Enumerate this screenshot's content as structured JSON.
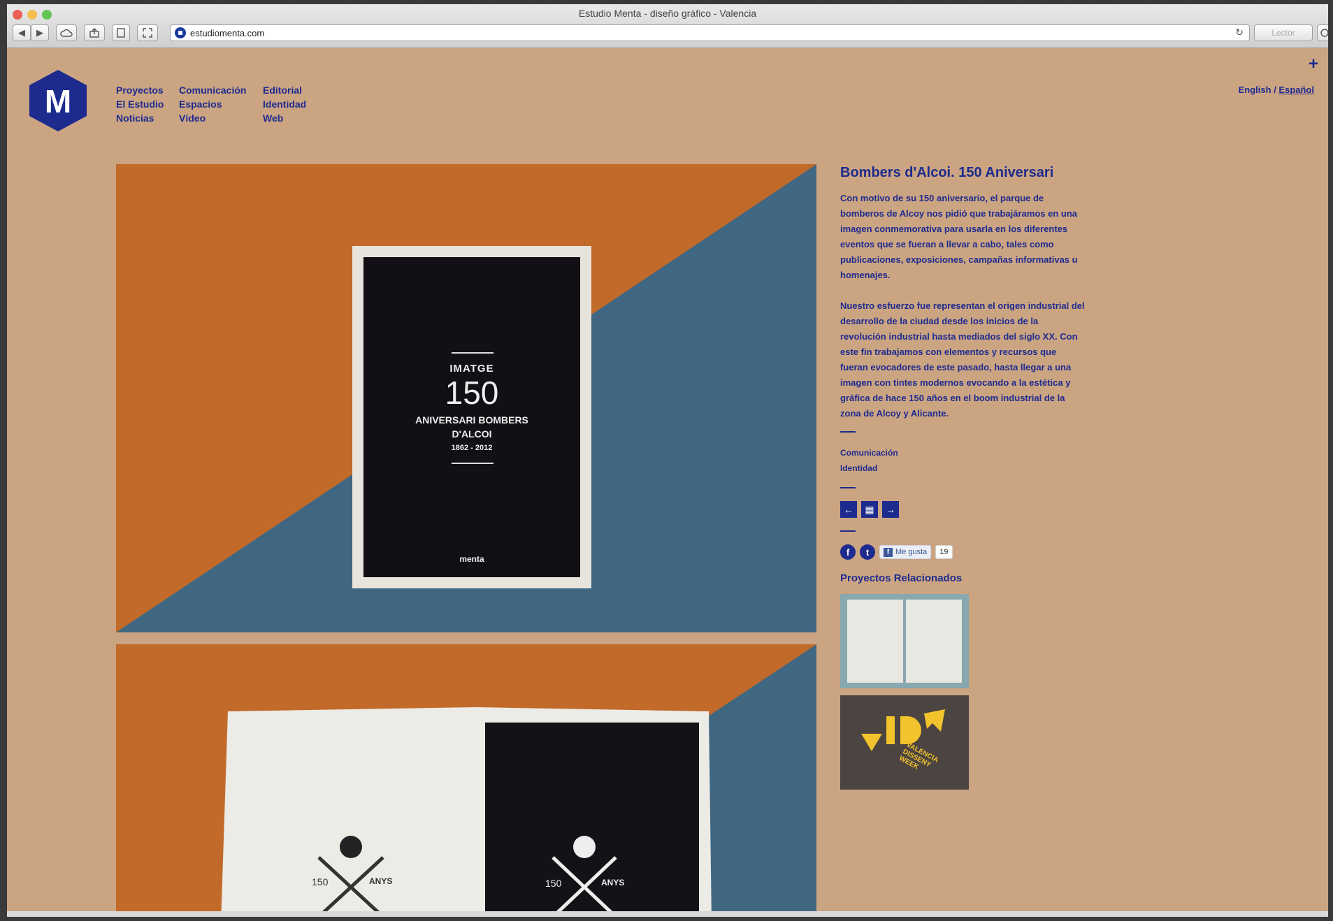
{
  "window": {
    "title": "Estudio Menta - diseño gráfico - Valencia"
  },
  "toolbar": {
    "back_glyph": "◀",
    "forward_glyph": "▶",
    "url": "estudiomenta.com",
    "reload_glyph": "↻",
    "reader_label": "Lector"
  },
  "logo": {
    "letter": "M"
  },
  "nav": {
    "col1": [
      "Proyectos",
      "El Estudio",
      "Noticias"
    ],
    "col2": [
      "Comunicación",
      "Espacios",
      "Vídeo"
    ],
    "col3": [
      "Editorial",
      "Identidad",
      "Web"
    ]
  },
  "lang": {
    "english": "English",
    "separator": " / ",
    "spanish": "Español"
  },
  "plus": "+",
  "hero": {
    "book_top": "IMATGE",
    "book_number": "150",
    "book_line1": "ANIVERSARI BOMBERS",
    "book_line2": "D'ALCOI",
    "book_years": "1862 - 2012",
    "book_brand": "menta"
  },
  "hero2": {
    "emblem_left": "150",
    "emblem_right": "ANYS"
  },
  "project": {
    "title": "Bombers d'Alcoi. 150 Aniversari",
    "para1": "Con motivo de su 150 aniversario, el parque de bomberos de Alcoy nos pidió que trabajáramos en una imagen conmemorativa para usarla en los diferentes eventos que se fueran a llevar a cabo, tales como publicaciones, exposiciones, campañas informativas u homenajes.",
    "para2": "Nuestro esfuerzo fue representan el origen industrial del desarrollo de la ciudad desde los inicios de la revolución industrial hasta mediados del siglo XX. Con este fin trabajamos con elementos y recursos que fueran evocadores de este pasado, hasta llegar a una imagen con tintes modernos evocando a la estética y gráfica de hace 150 años en el boom industrial de la zona de Alcoy y Alicante.",
    "tags": [
      "Comunicación",
      "Identidad"
    ],
    "prev_glyph": "←",
    "grid_glyph": "▦",
    "next_glyph": "→",
    "facebook_glyph": "f",
    "twitter_glyph": "t",
    "like_f": "f",
    "like_label": "Me gusta",
    "like_count": "19",
    "related_title": "Proyectos Relacionados",
    "vdw_text": "VALENCIA DISSENY WEEK"
  },
  "colors": {
    "background": "#cba482",
    "accent": "#1d2b8f"
  }
}
